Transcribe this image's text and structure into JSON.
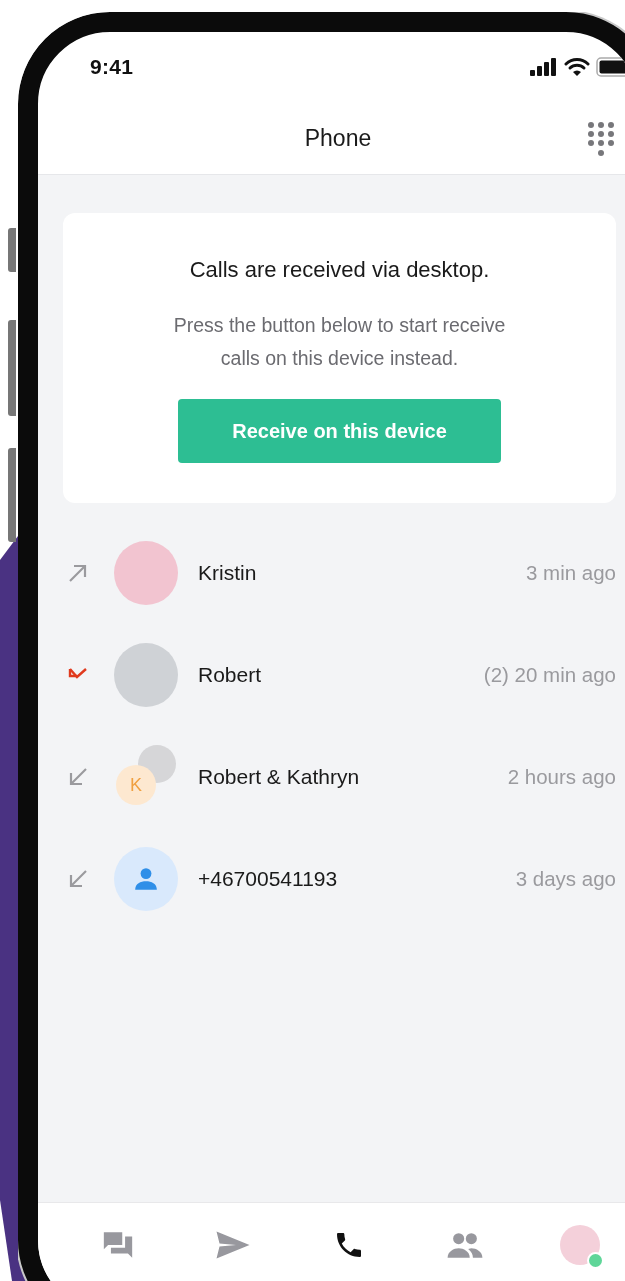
{
  "status_bar": {
    "time": "9:41"
  },
  "header": {
    "title": "Phone"
  },
  "notice": {
    "title": "Calls are received via desktop.",
    "message": "Press the button below to start receive calls on this device instead.",
    "button": "Receive on this device"
  },
  "calls": [
    {
      "kind": "outgoing",
      "avatar": {
        "kind": "photo"
      },
      "name": "Kristin",
      "time": "3 min ago"
    },
    {
      "kind": "missed",
      "avatar": {
        "kind": "photo"
      },
      "name": "Robert",
      "time": "(2) 20 min ago"
    },
    {
      "kind": "incoming",
      "avatar": {
        "kind": "group",
        "initial": "K"
      },
      "name": "Robert & Kathryn",
      "time": "2 hours ago"
    },
    {
      "kind": "incoming",
      "avatar": {
        "kind": "contact"
      },
      "name": "+46700541193",
      "time": "3 days ago"
    }
  ],
  "nav": [
    {
      "kind": "chats",
      "selected": false
    },
    {
      "kind": "send",
      "selected": false
    },
    {
      "kind": "calls",
      "selected": true
    },
    {
      "kind": "contacts",
      "selected": false
    },
    {
      "kind": "profile",
      "selected": false,
      "online": true
    }
  ]
}
